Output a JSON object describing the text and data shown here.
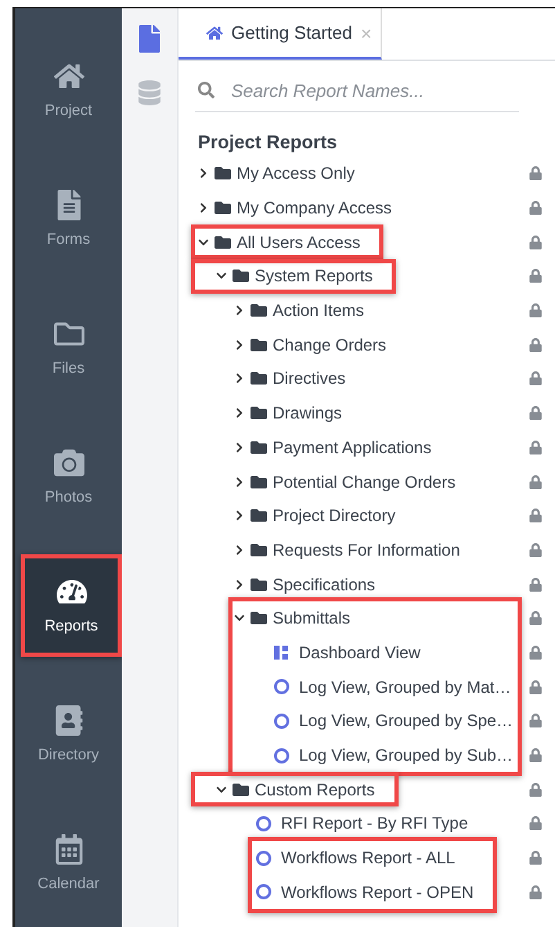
{
  "sidebar": {
    "items": [
      {
        "label": "Project",
        "selected": false,
        "highlighted": false
      },
      {
        "label": "Forms",
        "selected": false,
        "highlighted": false
      },
      {
        "label": "Files",
        "selected": false,
        "highlighted": false
      },
      {
        "label": "Photos",
        "selected": false,
        "highlighted": false
      },
      {
        "label": "Reports",
        "selected": true,
        "highlighted": true
      },
      {
        "label": "Directory",
        "selected": false,
        "highlighted": false
      },
      {
        "label": "Calendar",
        "selected": false,
        "highlighted": false
      }
    ]
  },
  "tabs": [
    {
      "label": "Getting Started",
      "selected": true,
      "close": "×"
    }
  ],
  "search": {
    "placeholder": "Search Report Names..."
  },
  "section_title": "Project Reports",
  "tree": [
    {
      "kind": "folder",
      "label": "My Access Only",
      "expanded": false,
      "locked": true,
      "highlighted": false
    },
    {
      "kind": "folder",
      "label": "My Company Access",
      "expanded": false,
      "locked": true,
      "highlighted": false
    },
    {
      "kind": "folder",
      "label": "All Users Access",
      "expanded": true,
      "locked": true,
      "highlighted": true,
      "children": [
        {
          "kind": "folder",
          "label": "System Reports",
          "expanded": true,
          "locked": true,
          "highlighted": true,
          "children": [
            {
              "kind": "folder",
              "label": "Action Items",
              "expanded": false,
              "locked": true,
              "highlighted": false
            },
            {
              "kind": "folder",
              "label": "Change Orders",
              "expanded": false,
              "locked": true,
              "highlighted": false
            },
            {
              "kind": "folder",
              "label": "Directives",
              "expanded": false,
              "locked": true,
              "highlighted": false
            },
            {
              "kind": "folder",
              "label": "Drawings",
              "expanded": false,
              "locked": true,
              "highlighted": false
            },
            {
              "kind": "folder",
              "label": "Payment Applications",
              "expanded": false,
              "locked": true,
              "highlighted": false
            },
            {
              "kind": "folder",
              "label": "Potential Change Orders",
              "expanded": false,
              "locked": true,
              "highlighted": false
            },
            {
              "kind": "folder",
              "label": "Project Directory",
              "expanded": false,
              "locked": true,
              "highlighted": false
            },
            {
              "kind": "folder",
              "label": "Requests For Information",
              "expanded": false,
              "locked": true,
              "highlighted": false
            },
            {
              "kind": "folder",
              "label": "Specifications",
              "expanded": false,
              "locked": true,
              "highlighted": false
            },
            {
              "kind": "folder",
              "label": "Submittals",
              "expanded": true,
              "locked": true,
              "highlighted": false,
              "group_highlighted": true,
              "children": [
                {
                  "kind": "dashboard",
                  "label": "Dashboard View",
                  "locked": true,
                  "highlighted": false
                },
                {
                  "kind": "report",
                  "label": "Log View, Grouped by Mat…",
                  "locked": true,
                  "highlighted": false
                },
                {
                  "kind": "report",
                  "label": "Log View, Grouped by Spe…",
                  "locked": true,
                  "highlighted": false
                },
                {
                  "kind": "report",
                  "label": "Log View, Grouped by Sub…",
                  "locked": true,
                  "highlighted": false
                }
              ]
            }
          ]
        },
        {
          "kind": "folder",
          "label": "Custom Reports",
          "expanded": true,
          "locked": true,
          "highlighted": true,
          "children": [
            {
              "kind": "report",
              "label": "RFI Report - By RFI Type",
              "locked": true,
              "highlighted": false
            },
            {
              "kind": "group",
              "highlighted": true,
              "children": [
                {
                  "kind": "report",
                  "label": "Workflows Report - ALL",
                  "locked": true,
                  "highlighted": false
                },
                {
                  "kind": "report",
                  "label": "Workflows Report - OPEN",
                  "locked": true,
                  "highlighted": false
                }
              ]
            }
          ]
        }
      ]
    }
  ]
}
